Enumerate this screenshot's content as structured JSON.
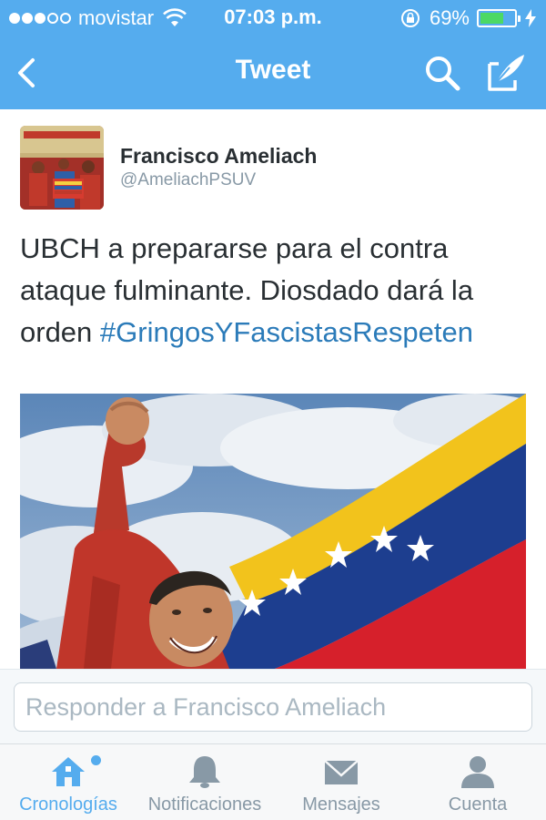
{
  "status_bar": {
    "carrier": "movistar",
    "time": "07:03 p.m.",
    "battery_percent": "69%",
    "battery_level": 0.69,
    "signal_bars": 3
  },
  "nav": {
    "title": "Tweet",
    "back_icon": "chevron-left-icon",
    "search_icon": "search-icon",
    "compose_icon": "compose-icon"
  },
  "tweet": {
    "author_name": "Francisco Ameliach",
    "author_handle": "@AmeliachPSUV",
    "text_plain": "UBCH a prepararse para el contra ataque fulminante. Diosdado dará la orden ",
    "hashtag": "#GringosYFascistasRespeten"
  },
  "reply": {
    "placeholder": "Responder a Francisco Ameliach"
  },
  "tabs": [
    {
      "label": "Cronologías",
      "icon": "home-icon",
      "active": true
    },
    {
      "label": "Notificaciones",
      "icon": "bell-icon",
      "active": false
    },
    {
      "label": "Mensajes",
      "icon": "envelope-icon",
      "active": false
    },
    {
      "label": "Cuenta",
      "icon": "person-icon",
      "active": false
    }
  ],
  "colors": {
    "brand_blue": "#55acee",
    "hashtag_blue": "#2b7bb9",
    "battery_green": "#4cd964",
    "text_dark": "#292f33",
    "text_muted": "#8899a6"
  }
}
